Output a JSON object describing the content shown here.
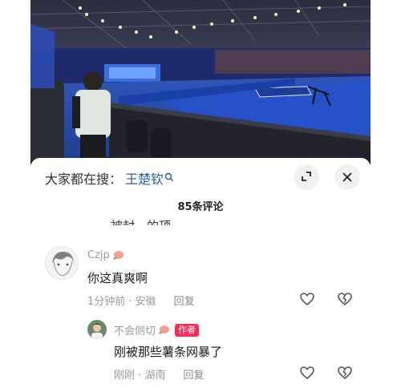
{
  "search": {
    "prefix": "大家都在搜：",
    "term": "王楚钦"
  },
  "header": {
    "comment_count": "85条评论",
    "cut_off_text": "被封…的顶"
  },
  "comments": [
    {
      "username": "Czjp",
      "text": "你这真爽啊",
      "time_location": "1分钟前 · 安徽",
      "reply_label": "回复"
    },
    {
      "username": "不会侧切",
      "author_tag": "作者",
      "text": "刚被那些薯条网暴了",
      "time_location": "刚刚 · 湖南",
      "reply_label": "回复"
    }
  ],
  "icons": {
    "search": "search-icon",
    "expand": "expand-icon",
    "close": "close-icon",
    "like": "heart-icon",
    "dislike": "broken-heart-icon",
    "badge": "ping-pong-paddle-icon"
  },
  "colors": {
    "accent": "#fe2c55",
    "search_term": "#1f5fa8",
    "secondary_text": "#9a9a9a"
  }
}
